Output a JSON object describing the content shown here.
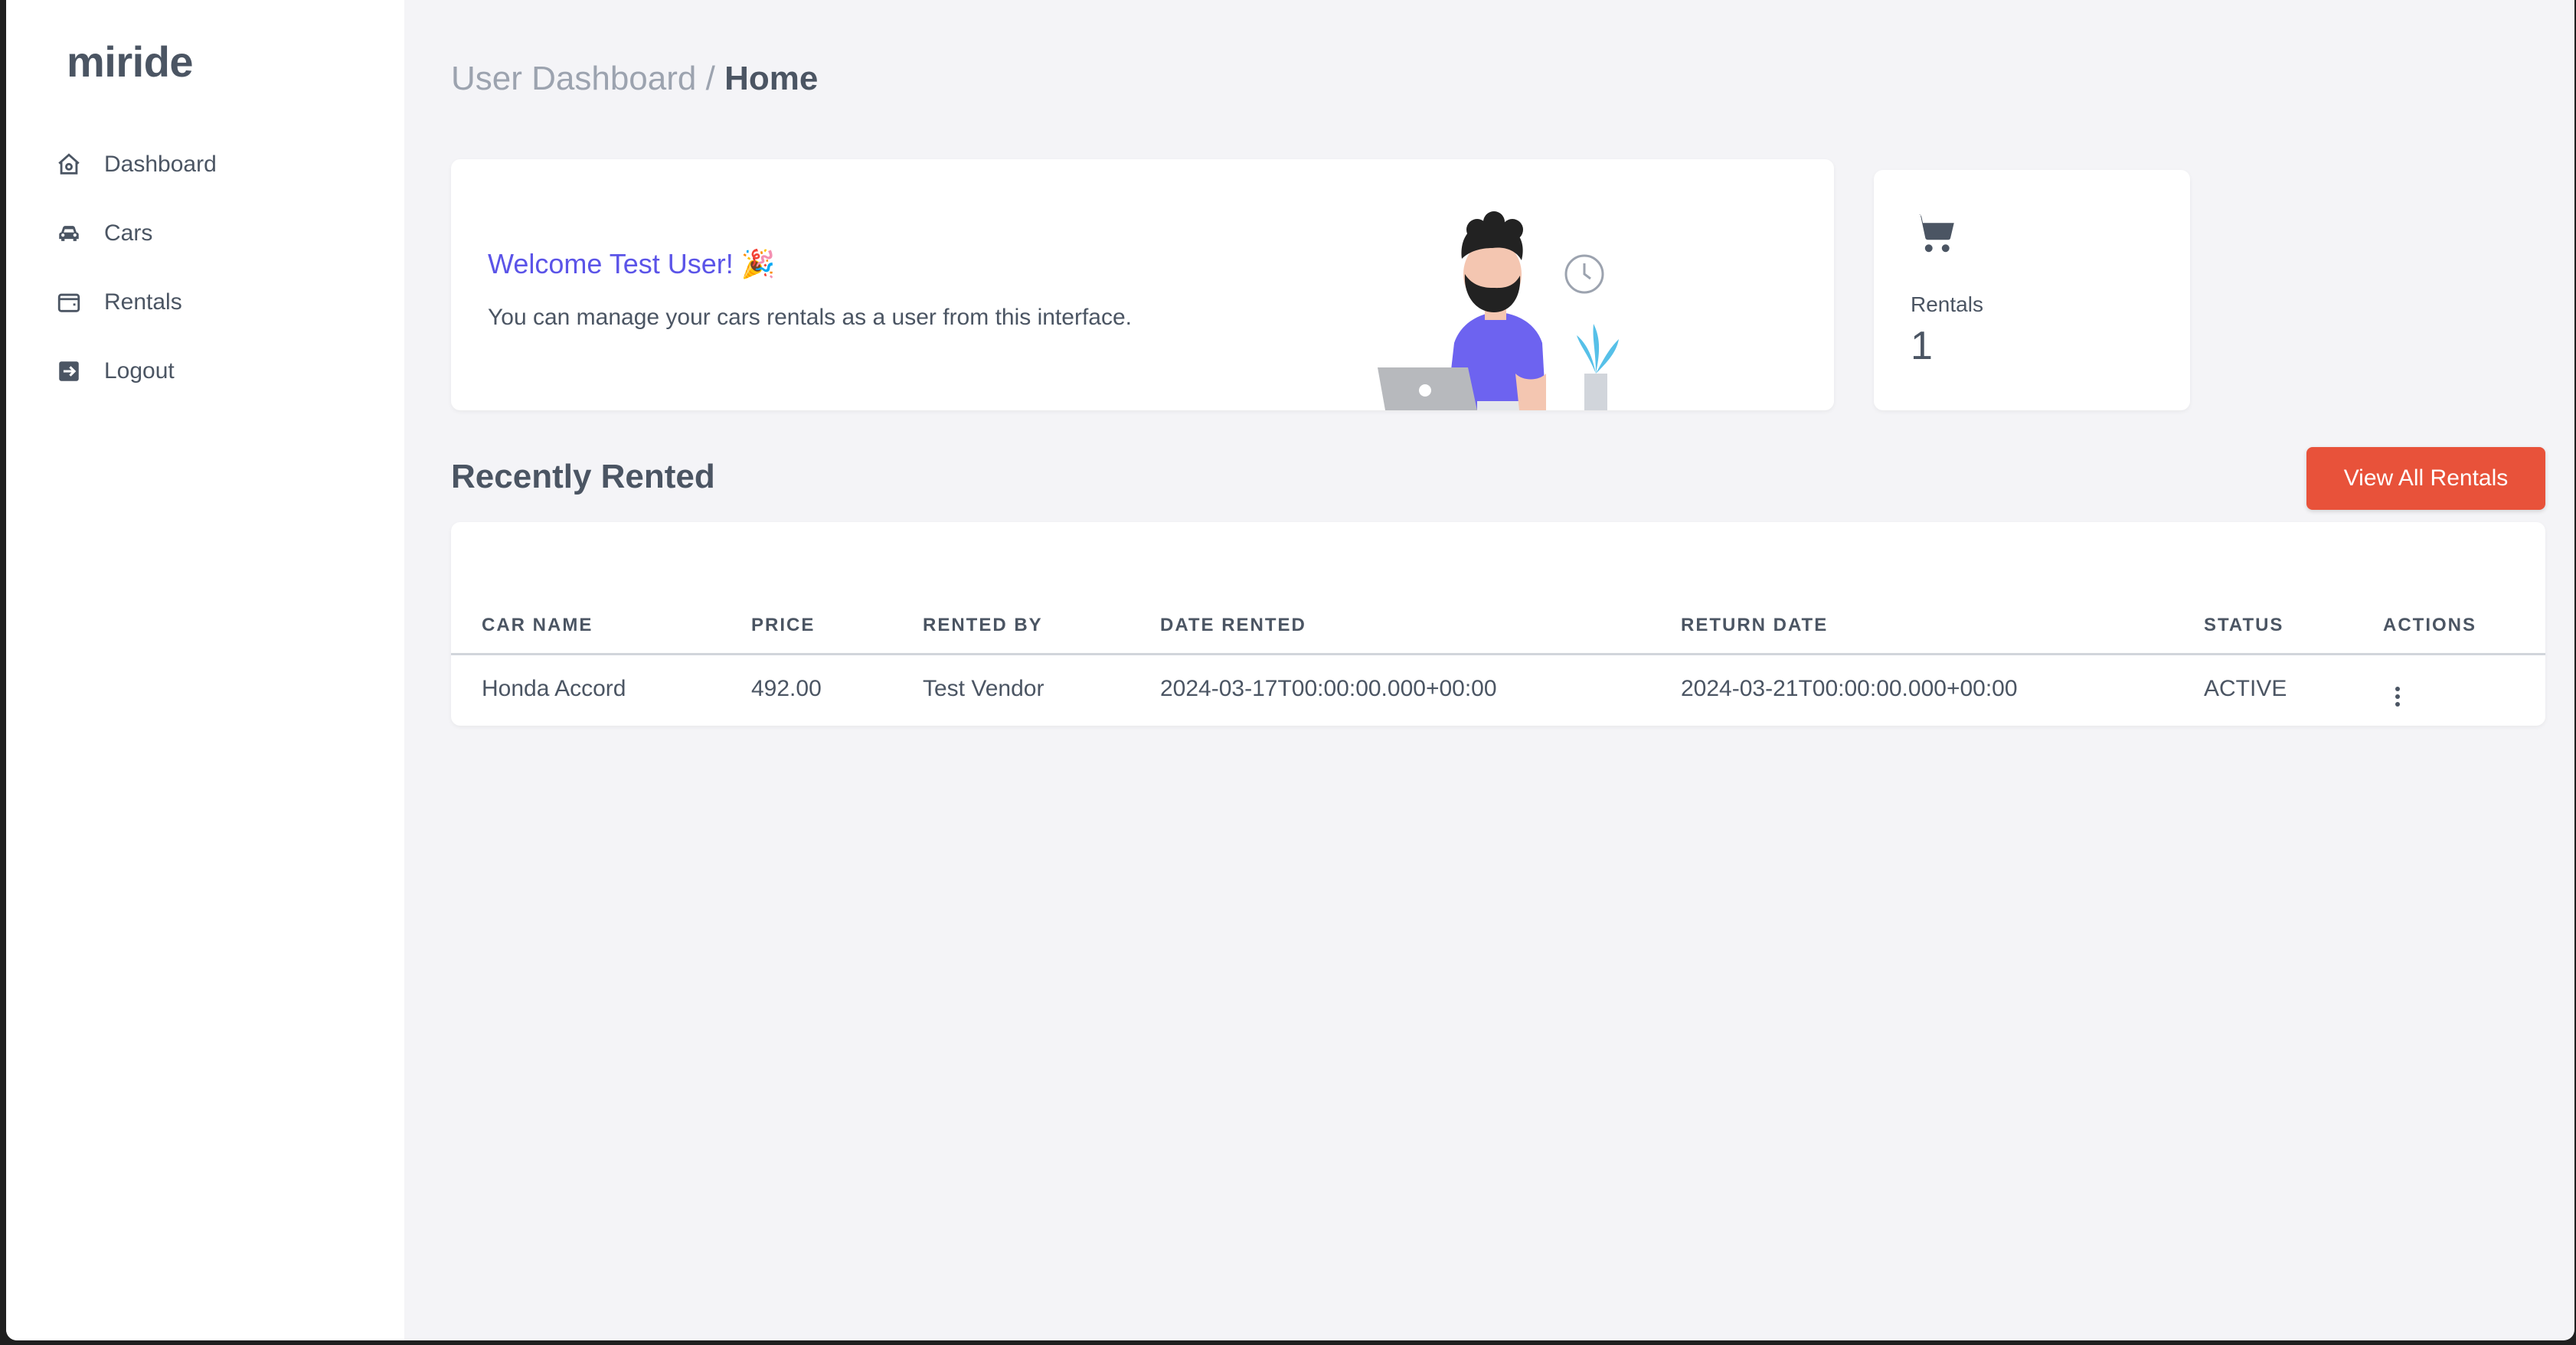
{
  "sidebar": {
    "brand": "miride",
    "items": [
      {
        "label": "Dashboard",
        "icon": "home-icon"
      },
      {
        "label": "Cars",
        "icon": "car-icon"
      },
      {
        "label": "Rentals",
        "icon": "wallet-icon"
      },
      {
        "label": "Logout",
        "icon": "logout-icon"
      }
    ]
  },
  "breadcrumb": {
    "parent": "User Dashboard",
    "separator": " / ",
    "current": "Home"
  },
  "welcome": {
    "title": "Welcome Test User! 🎉",
    "text": "You can manage your cars rentals as a user from this interface."
  },
  "stat": {
    "label": "Rentals",
    "value": "1",
    "icon": "cart-icon"
  },
  "recent": {
    "title": "Recently Rented",
    "button": "View All Rentals",
    "columns": [
      "CAR NAME",
      "PRICE",
      "RENTED BY",
      "DATE RENTED",
      "RETURN DATE",
      "STATUS",
      "ACTIONS"
    ],
    "rows": [
      {
        "car_name": "Honda Accord",
        "price": "492.00",
        "rented_by": "Test Vendor",
        "date_rented": "2024-03-17T00:00:00.000+00:00",
        "return_date": "2024-03-21T00:00:00.000+00:00",
        "status": "ACTIVE"
      }
    ]
  },
  "colors": {
    "accent": "#e8523a",
    "welcome": "#5b54e8",
    "text": "#4b5563"
  }
}
